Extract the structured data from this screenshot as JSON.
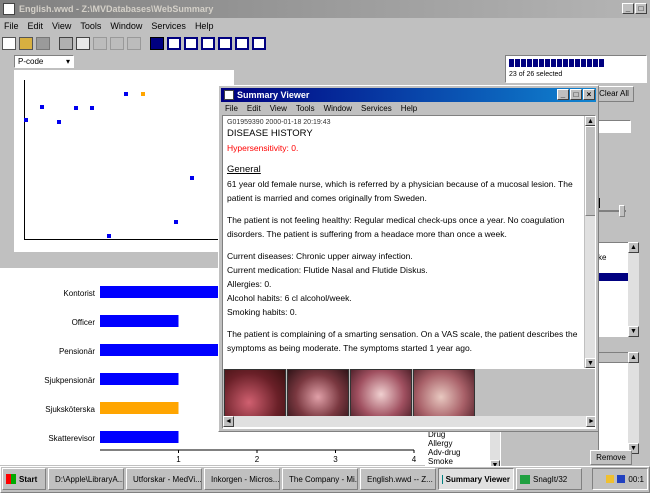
{
  "app": {
    "title": "English.wwd  -  Z:\\MVDatabases\\WebSummary"
  },
  "menu": [
    "File",
    "Edit",
    "View",
    "Tools",
    "Window",
    "Services",
    "Help"
  ],
  "pcode": {
    "selected": "P-code"
  },
  "chart": {
    "categories": [
      "Kontorist",
      "Officer",
      "Pensionär",
      "Sjukpensionär",
      "Sjuksköterska",
      "Skattere­visor"
    ],
    "ticks": [
      "1",
      "2",
      "3",
      "4"
    ]
  },
  "chart_data": {
    "type": "bar",
    "categories": [
      "Kontorist",
      "Officer",
      "Pensionär",
      "Sjukpensionär",
      "Sjuksköterska",
      "Skatterevisor"
    ],
    "values": [
      2.5,
      1,
      2.5,
      1,
      1,
      1
    ],
    "highlight_color": "#ffa500",
    "bar_color": "#0000ff",
    "highlighted": "Sjuksköterska",
    "x_ticks": [
      1,
      2,
      3,
      4
    ]
  },
  "right_panel": {
    "selection_text": "23 of 26 selected",
    "clear_all": "Clear All",
    "list_item_fragment": "ke",
    "remove": "Remove"
  },
  "summary": {
    "title": "Summary Viewer",
    "menu": [
      "File",
      "Edit",
      "View",
      "Tools",
      "Window",
      "Services",
      "Help"
    ],
    "id_line": "G01959390       2000-01-18 20:19:43",
    "heading": "DISEASE HISTORY",
    "hyper": "Hypersensitivity: 0.",
    "general_label": "General",
    "general_text": "61 year old female nurse, which is referred by a physician because of a mucosal lesion. The patient is married and comes originally from Sweden.",
    "healthy_text": "The patient is not feeling healthy: Regular medical check-ups once a year. No coagulation disorders.  The patient is suffering from a headace more than once a week.",
    "current_diseases": "Current diseases: Chronic upper airway infection.",
    "current_medication": "Current medication: Flutide Nasal and Flutide Diskus.",
    "allergies": "Allergies: 0.",
    "alcohol": "Alcohol habits: 6 cl alcohol/week.",
    "smoking": "Smoking habits: 0.",
    "complaint": "The patient is complaining of a smarting sensation. On a VAS scale, the patient describes the symptoms as being  moderate. The symptoms started 1 year ago."
  },
  "field_list": [
    "Drug",
    "Allergy",
    "Adv-drug",
    "Smoke"
  ],
  "taskbar": {
    "start": "Start",
    "items": [
      "D:\\Apple\\LibraryA...",
      "Utforskar - MedVi...",
      "Inkorgen - Micros...",
      "The Company - Mi...",
      "English.wwd -- Z...",
      "Summary Viewer",
      "SnagIt/32"
    ],
    "clock": "00:1"
  },
  "colors": {
    "title_active": "#000080",
    "hyper_red": "#ff0000",
    "bar_blue": "#0000ff",
    "bar_orange": "#ffa500"
  }
}
